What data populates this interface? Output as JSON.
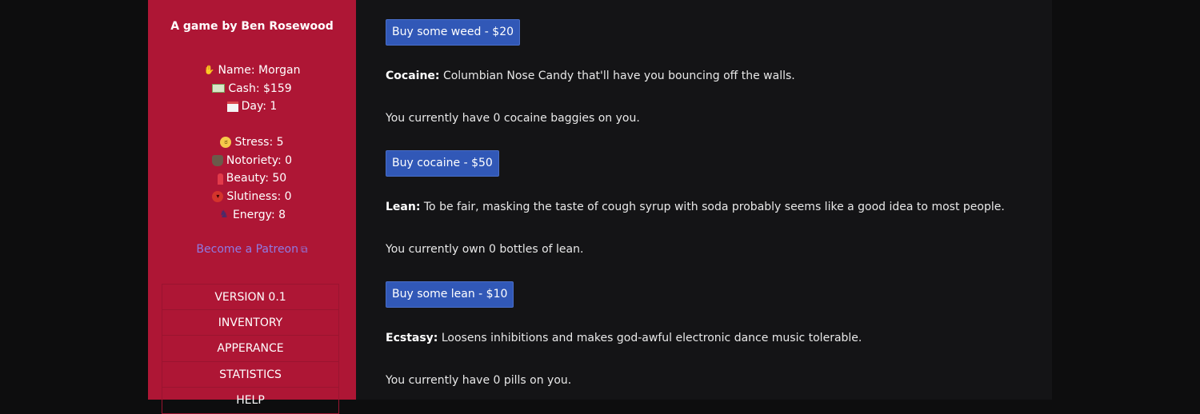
{
  "sidebar": {
    "byline": "A game by Ben Rosewood",
    "name": "Name: Morgan",
    "cash": "Cash: $159",
    "day": "Day: 1",
    "stress": "Stress: 5",
    "notoriety": "Notoriety: 0",
    "beauty": "Beauty: 50",
    "slutiness": "Slutiness: 0",
    "energy": "Energy: 8",
    "patreon_label": "Become a Patreon",
    "menu": [
      "VERSION 0.1",
      "INVENTORY",
      "APPERANCE",
      "STATISTICS",
      "HELP"
    ]
  },
  "icons": {
    "name": "waving-hand-icon",
    "cash": "banknote-icon",
    "day": "calendar-icon",
    "stress": "stressed-face-icon",
    "notoriety": "detective-icon",
    "beauty": "lipstick-icon",
    "slutiness": "devil-face-icon",
    "energy": "runner-icon",
    "patreon": "external-link-icon"
  },
  "main": {
    "buy_weed": "Buy some weed - $20",
    "cocaine_name": "Cocaine:",
    "cocaine_desc": " Columbian Nose Candy that'll have you bouncing off the walls.",
    "cocaine_owned": "You currently have 0 cocaine baggies on you.",
    "buy_cocaine": "Buy cocaine - $50",
    "lean_name": "Lean:",
    "lean_desc": " To be fair, masking the taste of cough syrup with soda probably seems like a good idea to most people.",
    "lean_owned": "You currently own 0 bottles of lean.",
    "buy_lean": "Buy some lean - $10",
    "ecstasy_name": "Ecstasy:",
    "ecstasy_desc": " Loosens inhibitions and makes god-awful electronic dance music tolerable.",
    "ecstasy_owned": "You currently have 0 pills on you."
  },
  "colors": {
    "background": "#0d0d0e",
    "sidebar": "#ae1635",
    "main": "#141416",
    "button": "#3158b7",
    "link": "#8f7be3"
  }
}
